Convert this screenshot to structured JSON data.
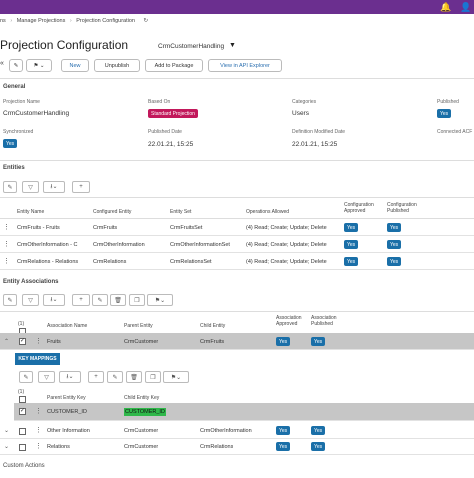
{
  "header": {
    "bell_icon": "bell-icon",
    "user_icon": "person-icon"
  },
  "breadcrumb": [
    "ns",
    "Manage Projections",
    "Projection Configuration"
  ],
  "page": {
    "title": "Projection Configuration",
    "subtitle": "CrmCustomerHandling"
  },
  "toolbar": {
    "new": "New",
    "unpublish": "Unpublish",
    "add_to_package": "Add to Package",
    "view_api": "View in API Explorer"
  },
  "general": {
    "section": "General",
    "projection_name_label": "Projection Name",
    "projection_name": "CrmCustomerHandling",
    "based_on_label": "Based On",
    "based_on": "Standard Projection",
    "categories_label": "Categories",
    "categories": "Users",
    "published_label": "Published",
    "published": "Yes",
    "synchronized_label": "Synchronized",
    "synchronized": "Yes",
    "published_date_label": "Published Date",
    "published_date": "22.01.21, 15:25",
    "def_modified_label": "Definition Modified Date",
    "def_modified": "22.01.21, 15:25",
    "connected_label": "Connected ACF"
  },
  "entities": {
    "section": "Entities",
    "columns": [
      "Entity Name",
      "Configured Entity",
      "Entity Set",
      "Operations Allowed",
      "Configuration Approved",
      "Configuration Published"
    ],
    "rows": [
      {
        "name": "CrmFruits - Fruits",
        "configured": "CrmFruits",
        "set": "CrmFruitsSet",
        "ops": "(4) Read; Create; Update; Delete",
        "approved": "Yes",
        "published": "Yes"
      },
      {
        "name": "CrmOtherInformation - C",
        "configured": "CrmOtherInformation",
        "set": "CrmOtherInformationSet",
        "ops": "(4) Read; Create; Update; Delete",
        "approved": "Yes",
        "published": "Yes"
      },
      {
        "name": "CrmRelations - Relations",
        "configured": "CrmRelations",
        "set": "CrmRelationsSet",
        "ops": "(4) Read; Create; Update; Delete",
        "approved": "Yes",
        "published": "Yes"
      }
    ]
  },
  "associations": {
    "section": "Entity Associations",
    "count_label": "(1)",
    "columns": [
      "Association Name",
      "Parent Entity",
      "Child Entity",
      "Association Approved",
      "Association Published"
    ],
    "rows": [
      {
        "name": "Fruits",
        "parent": "CrmCustomer",
        "child": "CrmFruits",
        "approved": "Yes",
        "published": "Yes"
      },
      {
        "name": "Other Information",
        "parent": "CrmCustomer",
        "child": "CrmOtherInformation",
        "approved": "Yes",
        "published": "Yes"
      },
      {
        "name": "Relations",
        "parent": "CrmCustomer",
        "child": "CrmRelations",
        "approved": "Yes",
        "published": "Yes"
      }
    ]
  },
  "key_mappings": {
    "tab": "KEY MAPPINGS",
    "count_label": "(1)",
    "columns": [
      "Parent Entity Key",
      "Child Entity Key"
    ],
    "row": {
      "parent": "CUSTOMER_ID",
      "child": "CUSTOMER_ID"
    }
  },
  "custom_actions": {
    "section": "Custom Actions"
  }
}
